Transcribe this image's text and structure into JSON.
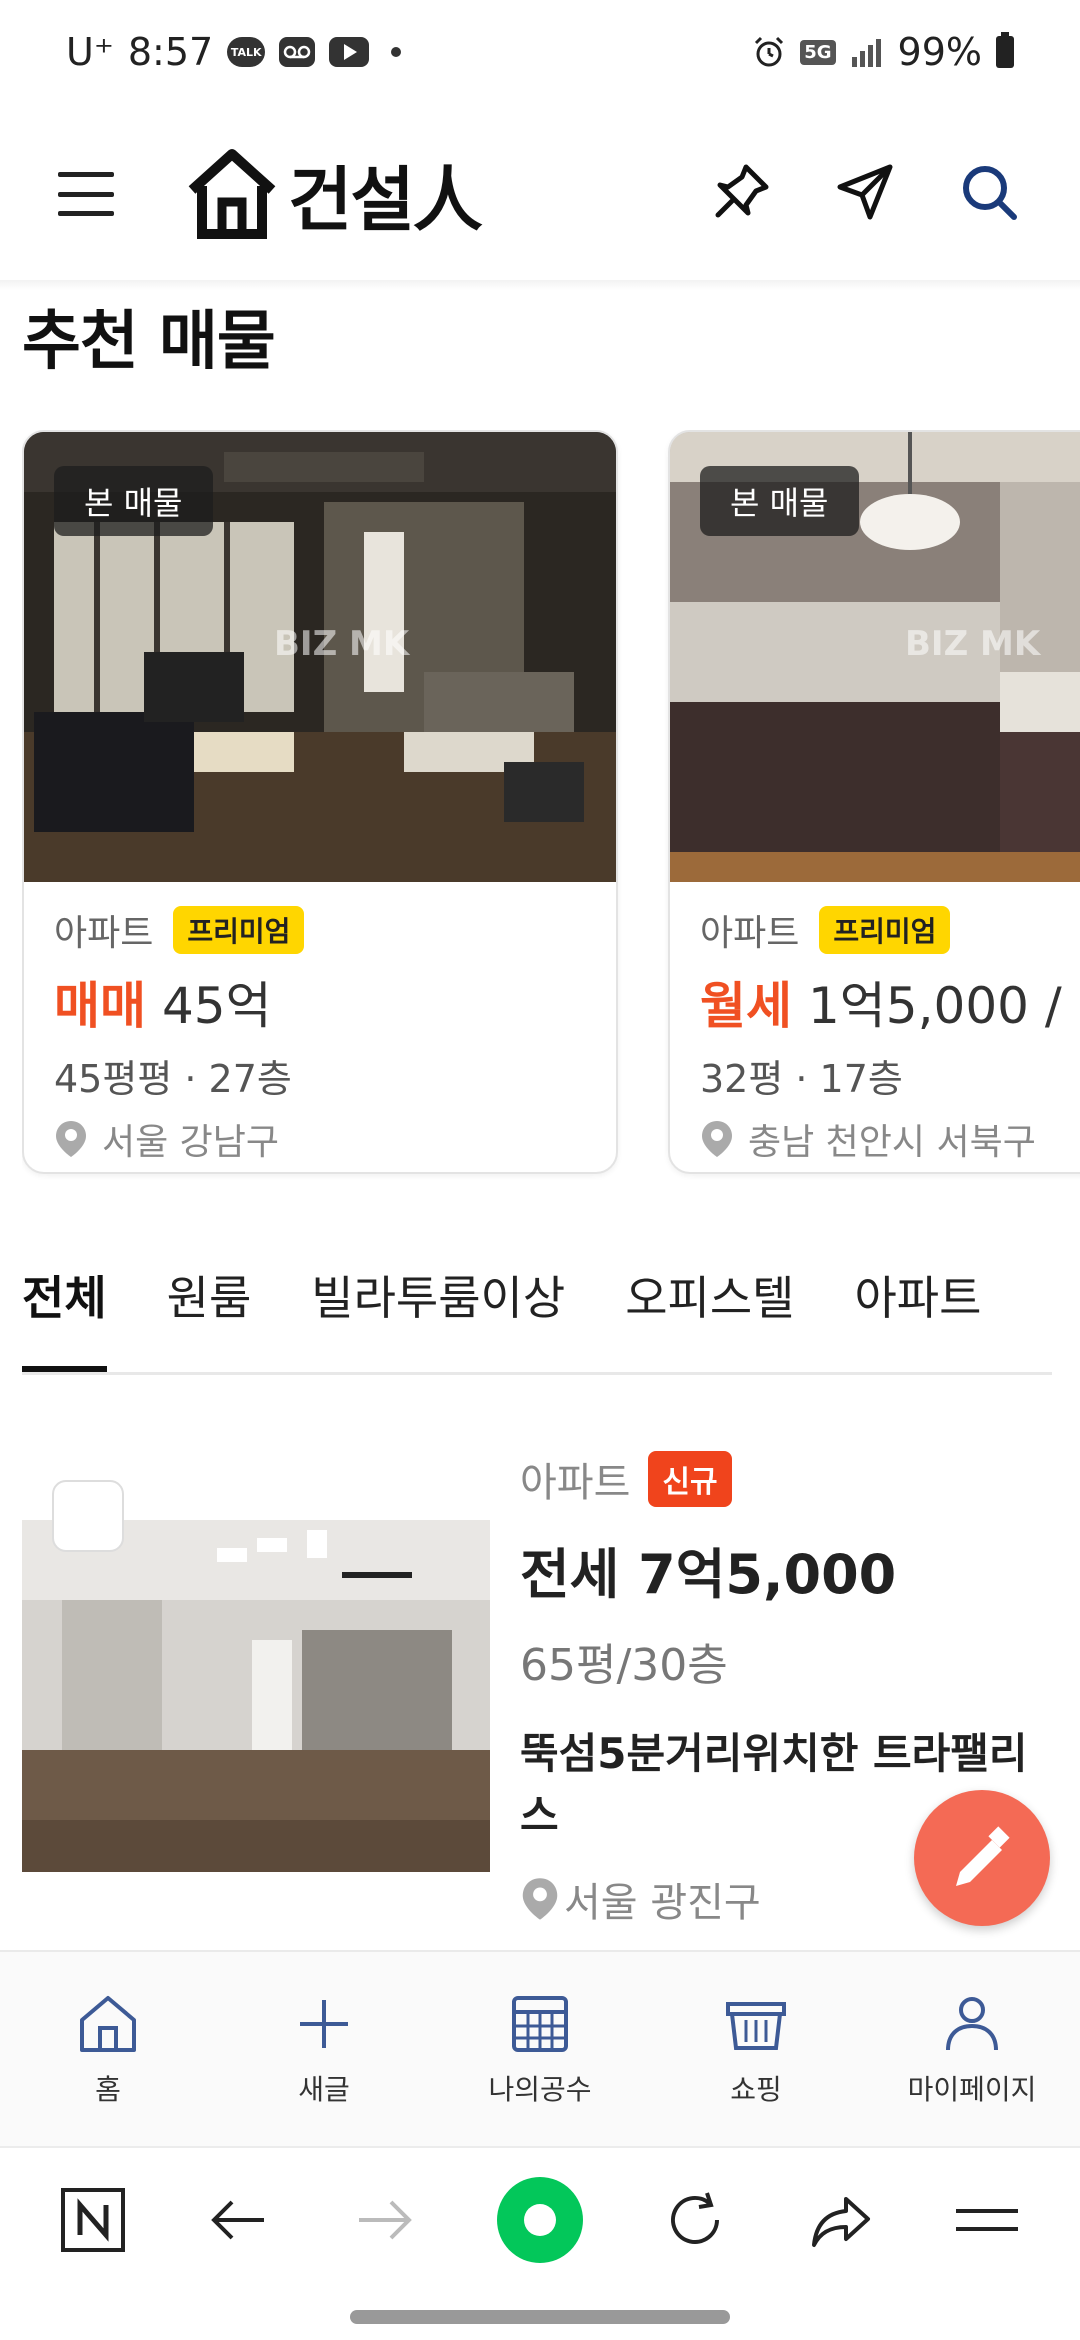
{
  "status_bar": {
    "carrier": "U⁺",
    "time": "8:57",
    "talk_label": "TALK",
    "network": "5G",
    "battery": "99%"
  },
  "header": {
    "logo_text": "건설人"
  },
  "recommended": {
    "title": "추천 매물",
    "cards": [
      {
        "seen_badge": "본 매물",
        "watermark": "BIZ MK",
        "type": "아파트",
        "tag": "프리미엄",
        "deal": "매매",
        "amount": "45억",
        "size": "45평평 · 27층",
        "location": "서울 강남구"
      },
      {
        "seen_badge": "본 매물",
        "watermark": "BIZ MK",
        "type": "아파트",
        "tag": "프리미엄",
        "deal": "월세",
        "amount": "1억5,000 /",
        "size": "32평 · 17층",
        "location": "충남 천안시 서북구"
      }
    ]
  },
  "tabs": [
    "전체",
    "원룸",
    "빌라투룸이상",
    "오피스텔",
    "아파트"
  ],
  "active_tab": "전체",
  "listing": {
    "type": "아파트",
    "badge": "신규",
    "price": "전세 7억5,000",
    "size": "65평/30층",
    "title": "뚝섬5분거리위치한 트라팰리스",
    "location": "서울 광진구"
  },
  "app_nav": {
    "items": [
      {
        "label": "홈",
        "icon": "home-icon"
      },
      {
        "label": "새글",
        "icon": "plus-icon"
      },
      {
        "label": "나의공수",
        "icon": "calculator-icon"
      },
      {
        "label": "쇼핑",
        "icon": "basket-icon"
      },
      {
        "label": "마이페이지",
        "icon": "person-icon"
      }
    ]
  },
  "colors": {
    "accent_orange": "#f05022",
    "premium_yellow": "#ffd600",
    "new_badge": "#f0441c",
    "fab": "#f46a55",
    "naver_green": "#03c75a"
  }
}
